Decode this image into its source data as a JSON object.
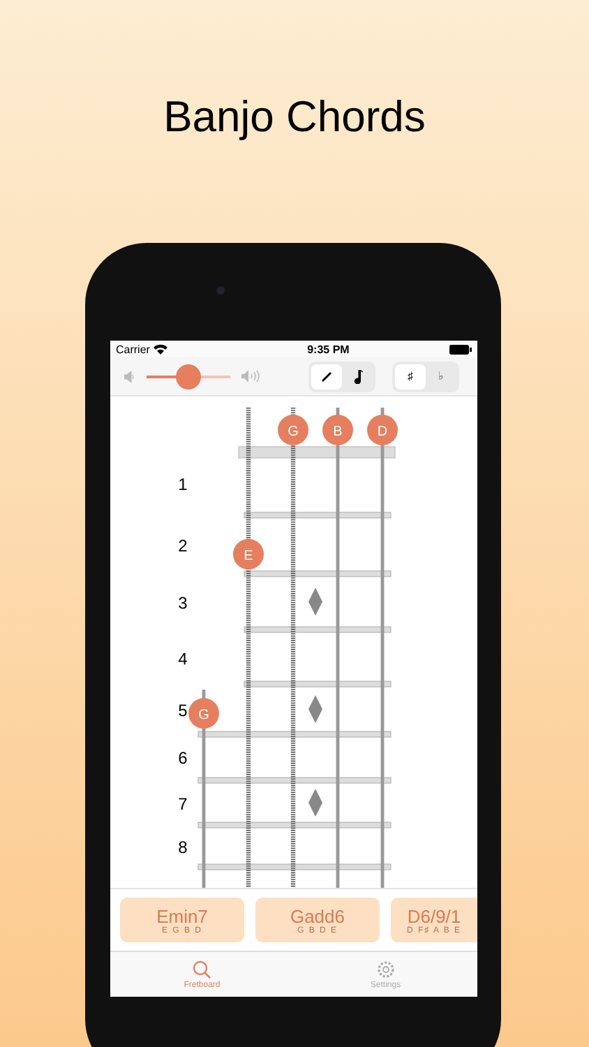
{
  "title": "Banjo Chords",
  "status_bar": {
    "carrier": "Carrier",
    "time": "9:35 PM"
  },
  "toolbar": {
    "volume": {
      "level": 0.5
    },
    "mode_toggle": [
      {
        "kind": "pick",
        "selected": true
      },
      {
        "kind": "note",
        "selected": false
      }
    ],
    "accidental_toggle": [
      {
        "label": "♯",
        "selected": true
      },
      {
        "label": "♭",
        "selected": false
      }
    ]
  },
  "fretboard": {
    "open_notes": [
      {
        "kind": "empty"
      },
      {
        "kind": "empty"
      },
      {
        "kind": "note",
        "label": "G"
      },
      {
        "kind": "note",
        "label": "B"
      },
      {
        "kind": "note",
        "label": "D"
      }
    ],
    "frets": [
      {
        "number": "1",
        "inlay": false,
        "notes": [
          {
            "kind": "empty"
          },
          {
            "kind": "empty"
          },
          {
            "kind": "empty"
          },
          {
            "kind": "empty"
          },
          {
            "kind": "empty"
          }
        ]
      },
      {
        "number": "2",
        "inlay": false,
        "notes": [
          {
            "kind": "empty"
          },
          {
            "kind": "note",
            "label": "E"
          },
          {
            "kind": "empty"
          },
          {
            "kind": "empty"
          },
          {
            "kind": "empty"
          }
        ]
      },
      {
        "number": "3",
        "inlay": true,
        "notes": [
          {
            "kind": "empty"
          },
          {
            "kind": "empty"
          },
          {
            "kind": "empty"
          },
          {
            "kind": "empty"
          },
          {
            "kind": "empty"
          }
        ]
      },
      {
        "number": "4",
        "inlay": false,
        "notes": [
          {
            "kind": "empty"
          },
          {
            "kind": "empty"
          },
          {
            "kind": "empty"
          },
          {
            "kind": "empty"
          },
          {
            "kind": "empty"
          }
        ]
      },
      {
        "number": "5",
        "inlay": true,
        "notes": [
          {
            "kind": "note",
            "label": "G"
          },
          {
            "kind": "empty"
          },
          {
            "kind": "empty"
          },
          {
            "kind": "empty"
          },
          {
            "kind": "empty"
          }
        ]
      },
      {
        "number": "6",
        "inlay": false,
        "notes": [
          {
            "kind": "empty"
          },
          {
            "kind": "empty"
          },
          {
            "kind": "empty"
          },
          {
            "kind": "empty"
          },
          {
            "kind": "empty"
          }
        ]
      },
      {
        "number": "7",
        "inlay": true,
        "notes": [
          {
            "kind": "empty"
          },
          {
            "kind": "empty"
          },
          {
            "kind": "empty"
          },
          {
            "kind": "empty"
          },
          {
            "kind": "empty"
          }
        ]
      },
      {
        "number": "8",
        "inlay": false,
        "notes": [
          {
            "kind": "empty"
          },
          {
            "kind": "empty"
          },
          {
            "kind": "empty"
          },
          {
            "kind": "empty"
          },
          {
            "kind": "empty"
          }
        ]
      }
    ]
  },
  "chords": [
    {
      "name": "Emin7",
      "notes": "E G B D"
    },
    {
      "name": "Gadd6",
      "notes": "G B D E"
    },
    {
      "name": "D6/9/1",
      "notes": "D F♯ A B E"
    }
  ],
  "tab_bar": [
    {
      "kind": "search",
      "label": "Fretboard",
      "selected": true
    },
    {
      "kind": "gear",
      "label": "Settings",
      "selected": false
    }
  ]
}
